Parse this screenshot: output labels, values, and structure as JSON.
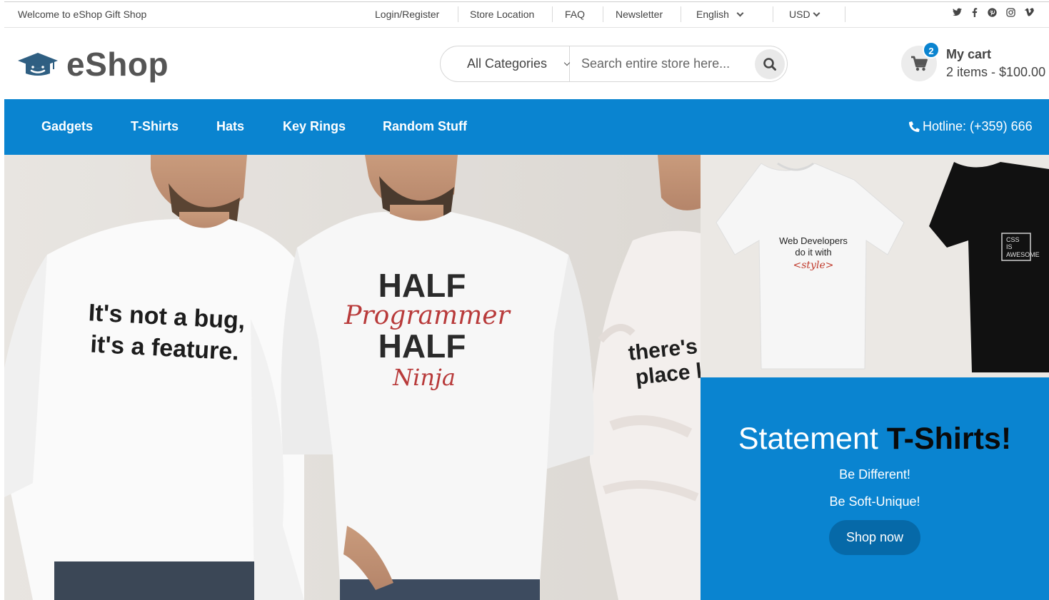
{
  "topbar": {
    "welcome": "Welcome to eShop Gift Shop",
    "links": [
      "Login/Register",
      "Store Location",
      "FAQ",
      "Newsletter"
    ],
    "language": "English",
    "currency": "USD",
    "social_icons": [
      "twitter-icon",
      "facebook-icon",
      "pinterest-icon",
      "instagram-icon",
      "vimeo-icon"
    ]
  },
  "header": {
    "logo_text": "eShop",
    "search": {
      "category": "All Categories",
      "placeholder": "Search entire store here..."
    },
    "cart": {
      "count": "2",
      "title": "My cart",
      "summary": "2 items - $100.00"
    }
  },
  "nav": {
    "items": [
      "Gadgets",
      "T-Shirts",
      "Hats",
      "Key Rings",
      "Random Stuff"
    ],
    "hotline": "Hotline: (+359) 666"
  },
  "hero": {
    "shirt1": [
      "It's not a bug,",
      "it's a feature."
    ],
    "shirt2": [
      "HALF",
      "Programmer",
      "HALF",
      "Ninja"
    ],
    "shirt3": [
      "there's n",
      "place lik"
    ]
  },
  "promo": {
    "image_shirt1": [
      "Web Developers",
      "do it with",
      "<style>"
    ],
    "image_shirt2": [
      "CSS",
      "IS",
      "AWESOME"
    ],
    "title_plain": "Statement ",
    "title_bold": "T-Shirts!",
    "line1": "Be Different!",
    "line2": "Be Soft-Unique!",
    "button": "Shop now"
  },
  "colors": {
    "accent": "#0a84d0",
    "button_dark": "#0669a8"
  }
}
